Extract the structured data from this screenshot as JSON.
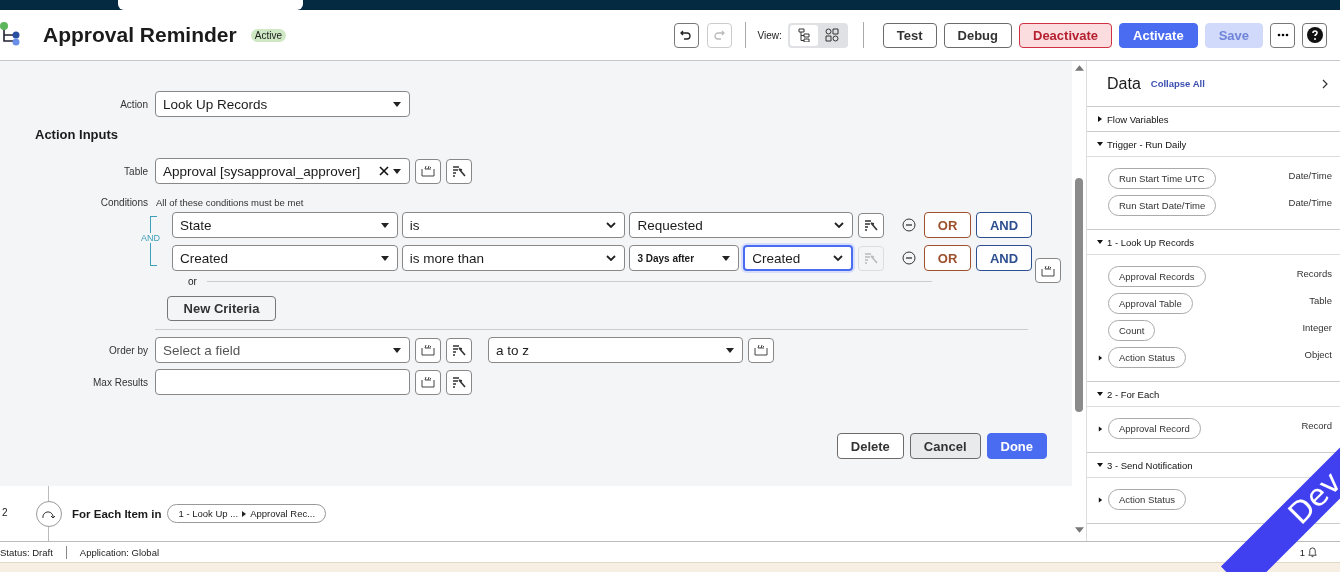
{
  "header": {
    "title": "Approval Reminder",
    "status_badge": "Active",
    "undo_disabled": false,
    "redo_disabled": true,
    "view_label": "View:",
    "view_modes": [
      {
        "kind": "tree",
        "selected": true
      },
      {
        "kind": "grid",
        "selected": false
      }
    ],
    "buttons": [
      {
        "label": "Test",
        "kind": "outline",
        "disabled": false
      },
      {
        "label": "Debug",
        "kind": "outline",
        "disabled": false
      },
      {
        "label": "Deactivate",
        "kind": "danger",
        "disabled": false
      },
      {
        "label": "Activate",
        "kind": "primary",
        "disabled": false
      },
      {
        "label": "Save",
        "kind": "primary",
        "disabled": true
      }
    ]
  },
  "action": {
    "label": "Action",
    "value": "Look Up Records"
  },
  "action_inputs": {
    "heading": "Action Inputs",
    "table": {
      "label": "Table",
      "value": "Approval [sysapproval_approver]"
    },
    "conditions": {
      "label": "Conditions",
      "note": "All of these conditions must be met",
      "joiner": "AND",
      "rows": [
        {
          "field": "State",
          "operator": "is",
          "value": "Requested",
          "value_focused": false,
          "picker_disabled": false,
          "or_button": "OR",
          "and_button": "AND"
        },
        {
          "field": "Created",
          "operator": "is more than",
          "modifier": "3 Days after",
          "value": "Created",
          "value_focused": true,
          "picker_disabled": true,
          "or_button": "OR",
          "and_button": "AND"
        }
      ],
      "or_label": "or",
      "new_criteria": "New Criteria"
    },
    "order_by": {
      "label": "Order by",
      "placeholder": "Select a field",
      "direction": "a to z"
    },
    "max_results": {
      "label": "Max Results"
    }
  },
  "footer_buttons": [
    {
      "label": "Delete",
      "kind": "outline"
    },
    {
      "label": "Cancel",
      "kind": "secondary"
    },
    {
      "label": "Done",
      "kind": "primary"
    }
  ],
  "step": {
    "number": "2",
    "label": "For Each Item in",
    "pill_source": "1 - Look Up ...",
    "pill_field": "Approval Rec..."
  },
  "data_panel": {
    "title": "Data",
    "collapse_all": "Collapse All",
    "sections": [
      {
        "title": "Flow Variables",
        "expanded": false
      },
      {
        "title": "Trigger - Run Daily",
        "expanded": true,
        "items": [
          {
            "label": "Run Start Time UTC",
            "type": "Date/Time",
            "expandable": false
          },
          {
            "label": "Run Start Date/Time",
            "type": "Date/Time",
            "expandable": false
          }
        ]
      },
      {
        "title": "1 - Look Up Records",
        "expanded": true,
        "items": [
          {
            "label": "Approval Records",
            "type": "Records",
            "expandable": false
          },
          {
            "label": "Approval Table",
            "type": "Table",
            "expandable": false
          },
          {
            "label": "Count",
            "type": "Integer",
            "expandable": false
          },
          {
            "label": "Action Status",
            "type": "Object",
            "expandable": true
          }
        ]
      },
      {
        "title": "2 - For Each",
        "expanded": true,
        "items": [
          {
            "label": "Approval Record",
            "type": "Record",
            "expandable": true
          }
        ]
      },
      {
        "title": "3 - Send Notification",
        "expanded": true,
        "items": [
          {
            "label": "Action Status",
            "expandable": true
          }
        ]
      }
    ]
  },
  "status_bar": {
    "status": "Status: Draft",
    "application": "Application: Global",
    "notifications": "1"
  },
  "environment_ribbon": "Dev"
}
